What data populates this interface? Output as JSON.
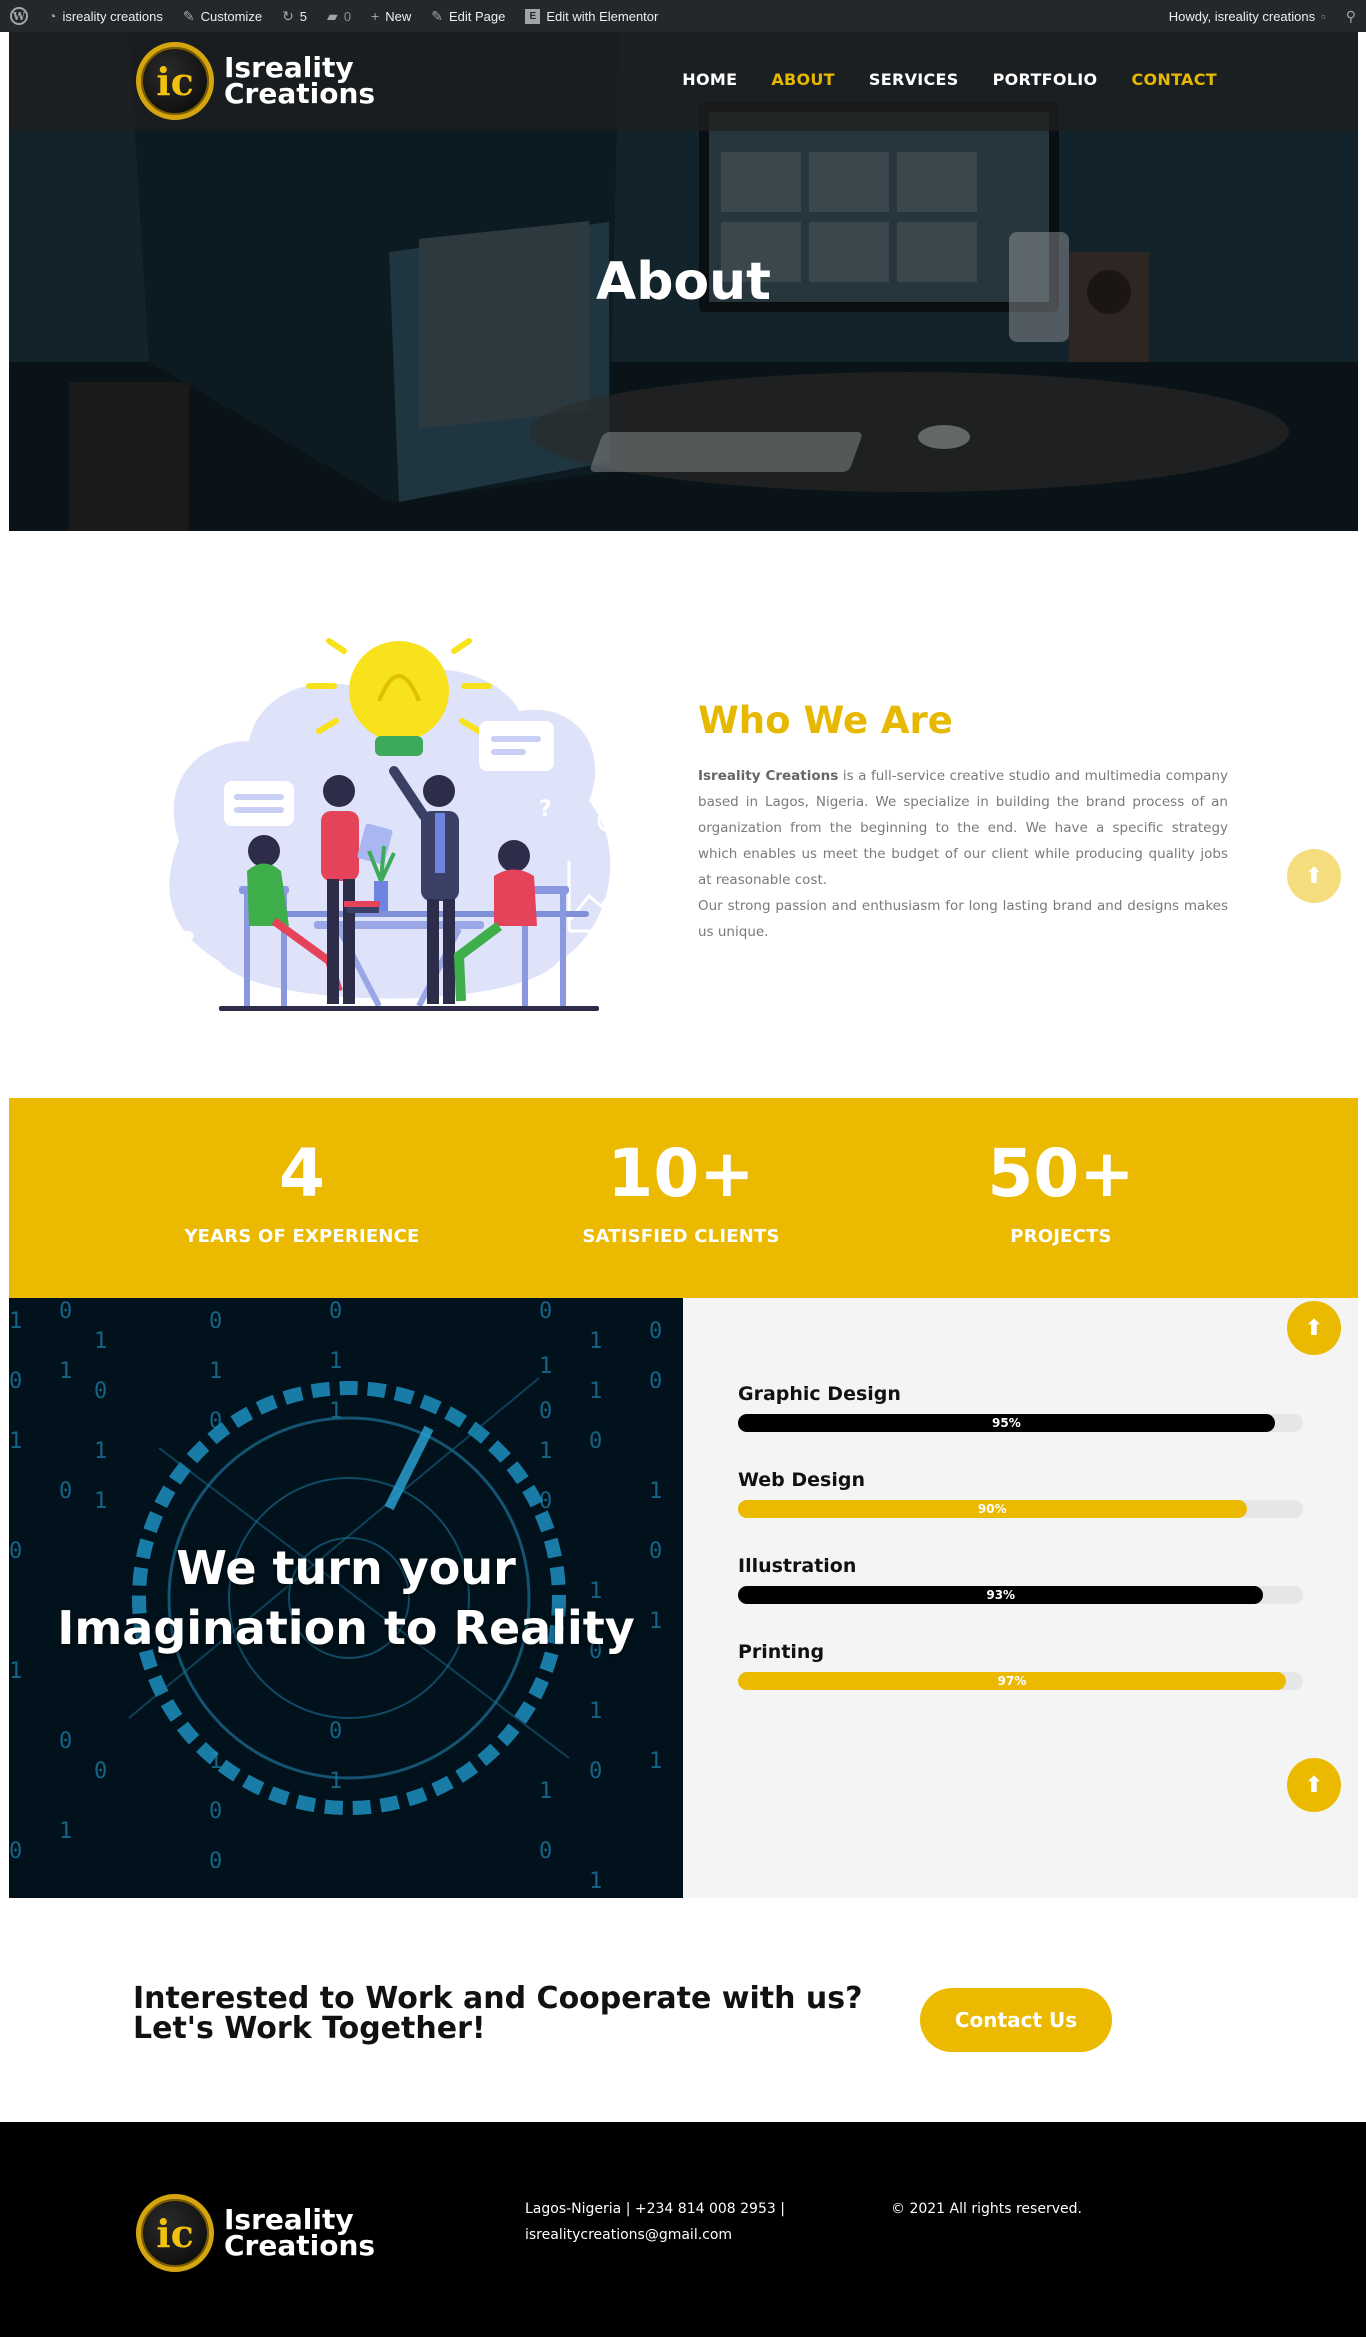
{
  "adminbar": {
    "site_name": "isreality creations",
    "customize": "Customize",
    "updates_count": "5",
    "comments_count": "0",
    "new": "New",
    "edit_page": "Edit Page",
    "edit_elementor": "Edit with Elementor",
    "howdy": "Howdy, isreality creations"
  },
  "brand": {
    "line1": "Isreality",
    "line2": "Creations",
    "mark": "ic"
  },
  "nav": {
    "items": [
      {
        "label": "HOME",
        "state": "default"
      },
      {
        "label": "ABOUT",
        "state": "active"
      },
      {
        "label": "SERVICES",
        "state": "default"
      },
      {
        "label": "PORTFOLIO",
        "state": "default"
      },
      {
        "label": "CONTACT",
        "state": "gold"
      }
    ]
  },
  "hero": {
    "title": "About"
  },
  "who": {
    "heading": "Who We Are",
    "company": "Isreality Creations",
    "paragraph1": " is a full-service creative studio and multimedia company based in Lagos, Nigeria. We specialize in building the brand process of an organization from the beginning to the end. We have a specific strategy which enables us meet the budget of our client while producing quality jobs at reasonable cost.",
    "paragraph2": "Our strong passion and enthusiasm for long lasting brand and designs makes us unique."
  },
  "stats": [
    {
      "value": "4",
      "label": "YEARS OF EXPERIENCE"
    },
    {
      "value": "10+",
      "label": "SATISFIED CLIENTS"
    },
    {
      "value": "50+",
      "label": "PROJECTS"
    }
  ],
  "imagination": {
    "line1": "We turn your",
    "line2": "Imagination to Reality"
  },
  "skills": [
    {
      "name": "Graphic Design",
      "percent": 95,
      "label": "95%",
      "color": "#000000"
    },
    {
      "name": "Web Design",
      "percent": 90,
      "label": "90%",
      "color": "#ebba00"
    },
    {
      "name": "Illustration",
      "percent": 93,
      "label": "93%",
      "color": "#000000"
    },
    {
      "name": "Printing",
      "percent": 97,
      "label": "97%",
      "color": "#ebba00"
    }
  ],
  "cta": {
    "line1": "Interested to Work and Cooperate with us?",
    "line2": "Let's Work Together!",
    "button": "Contact Us"
  },
  "footer": {
    "contact_line1": "Lagos-Nigeria | +234 814 008 2953 |",
    "contact_line2": "isrealitycreations@gmail.com",
    "copyright": "© 2021 All rights reserved."
  },
  "colors": {
    "accent": "#ebba00",
    "dark": "#000000",
    "adminbar": "#23282d"
  },
  "icons": {
    "scroll_top": "arrow-up-icon"
  }
}
